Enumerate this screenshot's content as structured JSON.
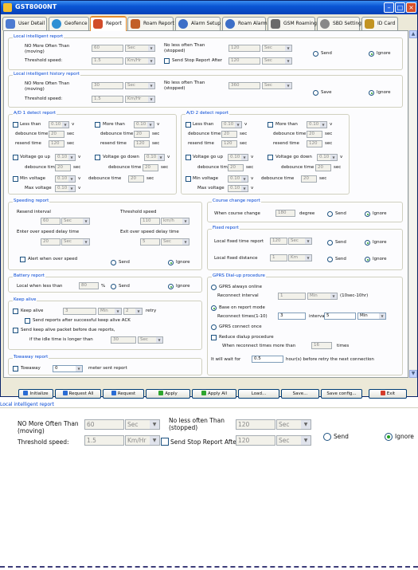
{
  "app": {
    "title": "GST8000NT"
  },
  "tabs": [
    {
      "label": "User Detail",
      "icon": "user-icon",
      "color": "#4d7bd1"
    },
    {
      "label": "Geofence",
      "icon": "globe-icon",
      "color": "#2e8fd4"
    },
    {
      "label": "Report",
      "icon": "report-icon",
      "color": "#d24c2a"
    },
    {
      "label": "Roam Report",
      "icon": "roam-icon",
      "color": "#c25f28"
    },
    {
      "label": "Alarm Setup",
      "icon": "alarm-icon",
      "color": "#3d6fc7"
    },
    {
      "label": "Roam Alarm",
      "icon": "roam-alarm-icon",
      "color": "#3d6fc7"
    },
    {
      "label": "GSM Roaming",
      "icon": "tools-icon",
      "color": "#6a6a6a"
    },
    {
      "label": "SBD Setting",
      "icon": "gear-icon",
      "color": "#888"
    },
    {
      "label": "ID Card",
      "icon": "id-card-icon",
      "color": "#c29422"
    }
  ],
  "local_report": {
    "title": "Local intelligent report",
    "no_more_label": "NO More Often Than (moving)",
    "no_more_value": "60",
    "no_more_unit": "Sec",
    "no_less_label": "No less often Than (stopped)",
    "no_less_value": "120",
    "no_less_unit": "Sec",
    "threshold_label": "Threshold speed:",
    "threshold_value": "1.5",
    "threshold_unit": "Km/Hr",
    "stop_label": "Send Stop Report After",
    "stop_value": "120",
    "stop_unit": "Sec",
    "send": "Send",
    "ignore": "Ignore"
  },
  "history_report": {
    "title": "Local intelligent history report",
    "no_more_label": "NO More Often Than (moving)",
    "no_more_value": "30",
    "no_more_unit": "Sec",
    "no_less_label": "No less often Than (stopped)",
    "no_less_value": "360",
    "no_less_unit": "Sec",
    "threshold_label": "Threshold speed:",
    "threshold_value": "1.5",
    "threshold_unit": "Km/Hr",
    "save": "Save",
    "ignore": "Ignore"
  },
  "ad1": {
    "title": "A/D 1 detect report",
    "less": "Less than",
    "less_v": "0.10",
    "more": "More than",
    "more_v": "0.10",
    "v": "v",
    "debounce": "debounce time",
    "debounce_v": "20",
    "sec": "sec",
    "resend": "resend time",
    "resend_v": "120",
    "vgoup": "Voltage go up",
    "vgoup_v": "0.10",
    "vgodown": "Voltage go down",
    "vgodown_v": "0.10",
    "min": "Min voltage",
    "min_v": "0.10",
    "max": "Max voltage",
    "max_v": "0.10"
  },
  "ad2": {
    "title": "A/D 2 detect report",
    "less": "Less than",
    "less_v": "0.10",
    "more": "More than",
    "more_v": "0.10",
    "v": "v",
    "debounce": "debounce time",
    "debounce_v": "20",
    "sec": "sec",
    "resend": "resend time",
    "resend_v": "120",
    "vgoup": "Voltage go up",
    "vgoup_v": "0.10",
    "vgodown": "Voltage go down",
    "vgodown_v": "0.10",
    "min": "Min voltage",
    "min_v": "0.10",
    "max": "Max voltage",
    "max_v": "0.10"
  },
  "speeding": {
    "title": "Speeding report",
    "resend": "Resend interval",
    "resend_v": "60",
    "resend_u": "Sec",
    "threshold": "Threshold speed",
    "threshold_v": "110",
    "threshold_u": "km/h",
    "enter": "Enter over speed delay time",
    "enter_v": "20",
    "enter_u": "Sec",
    "exit": "Exit over speed delay time",
    "exit_v": "5",
    "exit_u": "Sec",
    "alert": "Alert when over speed",
    "send": "Send",
    "ignore": "Ignore"
  },
  "course": {
    "title": "Course change report",
    "label": "When course change",
    "value": "180",
    "unit": "degree",
    "send": "Send",
    "ignore": "Ignore"
  },
  "fixed": {
    "title": "Fixed report",
    "time_label": "Local fixed time report",
    "time_v": "120",
    "time_u": "Sec",
    "dist_label": "Local fixed distance",
    "dist_v": "1",
    "dist_u": "Km",
    "send": "Send",
    "ignore": "Ignore"
  },
  "battery": {
    "title": "Battery report",
    "label": "Local when less than",
    "value": "80",
    "unit": "%",
    "send": "Send",
    "ignore": "Ignore"
  },
  "keepalive": {
    "title": "Keep alive",
    "keep": "Keep alive",
    "keep_v": "3",
    "keep_u": "Min",
    "retry_v": "2",
    "retry": "retry",
    "ack": "Send reports after successful keep alive ACK",
    "packet": "Send keep alive packet before due reports,",
    "idle": "if the idle time is longer than",
    "idle_v": "30",
    "idle_u": "Sec"
  },
  "towaway": {
    "title": "Towaway report",
    "label": "Towaway",
    "value": "0",
    "suffix": "meter sent report"
  },
  "gprs": {
    "title": "GPRS Dial-up procedure",
    "always": "GPRS always online",
    "reconnect": "Reconnect interval",
    "reconnect_v": "1",
    "reconnect_u": "Min",
    "range": "(10sec-10hr)",
    "base": "Base on report mode",
    "times": "Reconnect times(1-10)",
    "times_v": "3",
    "interval": "interval",
    "interval_v": "5",
    "interval_u": "Min",
    "once": "GPRS connect once",
    "reduce": "Reduce dialup procedure",
    "more": "When reconnect times more than",
    "more_v": "16",
    "more_u": "times",
    "wait": "It will wait for",
    "wait_v": "0.5",
    "wait_suffix": "hour(s) before retry the next connection"
  },
  "buttons": [
    {
      "label": "Initialize",
      "icon": "initialize-icon",
      "color": "#2a6cd4"
    },
    {
      "label": "Request All",
      "icon": "request-all-icon",
      "color": "#2a6cd4"
    },
    {
      "label": "Request",
      "icon": "request-icon",
      "color": "#2a6cd4"
    },
    {
      "label": "Apply",
      "icon": "apply-icon",
      "color": "#2fa52f"
    },
    {
      "label": "Apply All",
      "icon": "apply-all-icon",
      "color": "#2fa52f"
    },
    {
      "label": "Load...",
      "icon": "",
      "color": ""
    },
    {
      "label": "Save...",
      "icon": "",
      "color": ""
    },
    {
      "label": "Save config...",
      "icon": "",
      "color": ""
    },
    {
      "label": "Exit",
      "icon": "exit-icon",
      "color": "#d43c2a"
    }
  ]
}
